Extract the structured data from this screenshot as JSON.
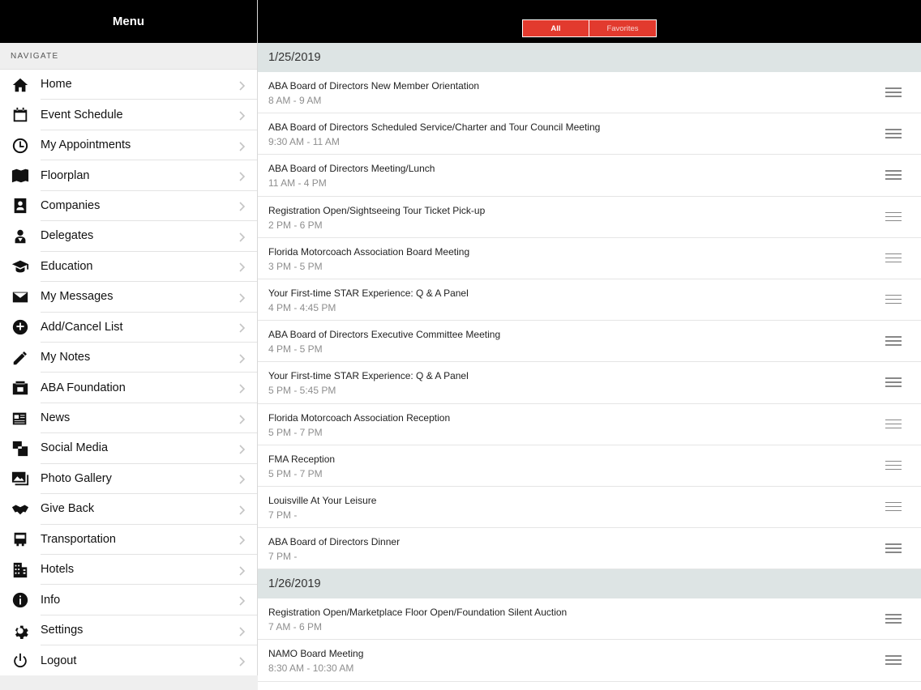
{
  "sidebar": {
    "title": "Menu",
    "section": "NAVIGATE",
    "items": [
      {
        "label": "Home",
        "icon": "home-icon"
      },
      {
        "label": "Event Schedule",
        "icon": "calendar-icon"
      },
      {
        "label": "My Appointments",
        "icon": "clock-icon"
      },
      {
        "label": "Floorplan",
        "icon": "map-icon"
      },
      {
        "label": "Companies",
        "icon": "address-book-icon"
      },
      {
        "label": "Delegates",
        "icon": "delegates-icon"
      },
      {
        "label": "Education",
        "icon": "graduation-cap-icon"
      },
      {
        "label": "My Messages",
        "icon": "envelope-icon"
      },
      {
        "label": "Add/Cancel List",
        "icon": "add-cancel-icon"
      },
      {
        "label": "My Notes",
        "icon": "pencil-icon"
      },
      {
        "label": "ABA Foundation",
        "icon": "foundation-icon"
      },
      {
        "label": "News",
        "icon": "newspaper-icon"
      },
      {
        "label": "Social Media",
        "icon": "social-media-icon"
      },
      {
        "label": "Photo Gallery",
        "icon": "photo-gallery-icon"
      },
      {
        "label": "Give Back",
        "icon": "handshake-icon"
      },
      {
        "label": "Transportation",
        "icon": "bus-icon"
      },
      {
        "label": "Hotels",
        "icon": "building-icon"
      },
      {
        "label": "Info",
        "icon": "info-icon"
      },
      {
        "label": "Settings",
        "icon": "gear-icon"
      },
      {
        "label": "Logout",
        "icon": "power-icon"
      }
    ]
  },
  "topbar": {
    "tabs": {
      "all": "All",
      "favorites": "Favorites"
    }
  },
  "colors": {
    "accent": "#e23a2e",
    "header": "#000000",
    "day_header": "#dde4e4"
  },
  "schedule": [
    {
      "date": "1/25/2019",
      "events": [
        {
          "title": "ABA Board of Directors New Member Orientation",
          "time": "8 AM - 9 AM"
        },
        {
          "title": "ABA Board of Directors Scheduled Service/Charter and Tour Council Meeting",
          "time": "9:30 AM - 11 AM"
        },
        {
          "title": "ABA Board of Directors Meeting/Lunch",
          "time": "11 AM - 4 PM"
        },
        {
          "title": "Registration Open/Sightseeing Tour Ticket Pick-up",
          "time": "2 PM - 6 PM"
        },
        {
          "title": "Florida Motorcoach Association Board Meeting",
          "time": "3 PM - 5 PM"
        },
        {
          "title": "Your First-time STAR Experience: Q & A Panel",
          "time": "4 PM - 4:45 PM"
        },
        {
          "title": "ABA Board of Directors Executive Committee Meeting",
          "time": "4 PM - 5 PM"
        },
        {
          "title": "Your First-time STAR Experience: Q & A Panel",
          "time": "5 PM - 5:45 PM"
        },
        {
          "title": "Florida Motorcoach Association Reception",
          "time": "5 PM - 7 PM"
        },
        {
          "title": "FMA Reception",
          "time": "5 PM - 7 PM"
        },
        {
          "title": "Louisville At Your Leisure",
          "time": "7 PM -"
        },
        {
          "title": "ABA Board of Directors Dinner",
          "time": "7 PM -"
        }
      ]
    },
    {
      "date": "1/26/2019",
      "events": [
        {
          "title": "Registration Open/Marketplace Floor Open/Foundation Silent Auction",
          "time": "7 AM - 6 PM"
        },
        {
          "title": "NAMO Board Meeting",
          "time": "8:30 AM - 10:30 AM"
        }
      ]
    }
  ]
}
